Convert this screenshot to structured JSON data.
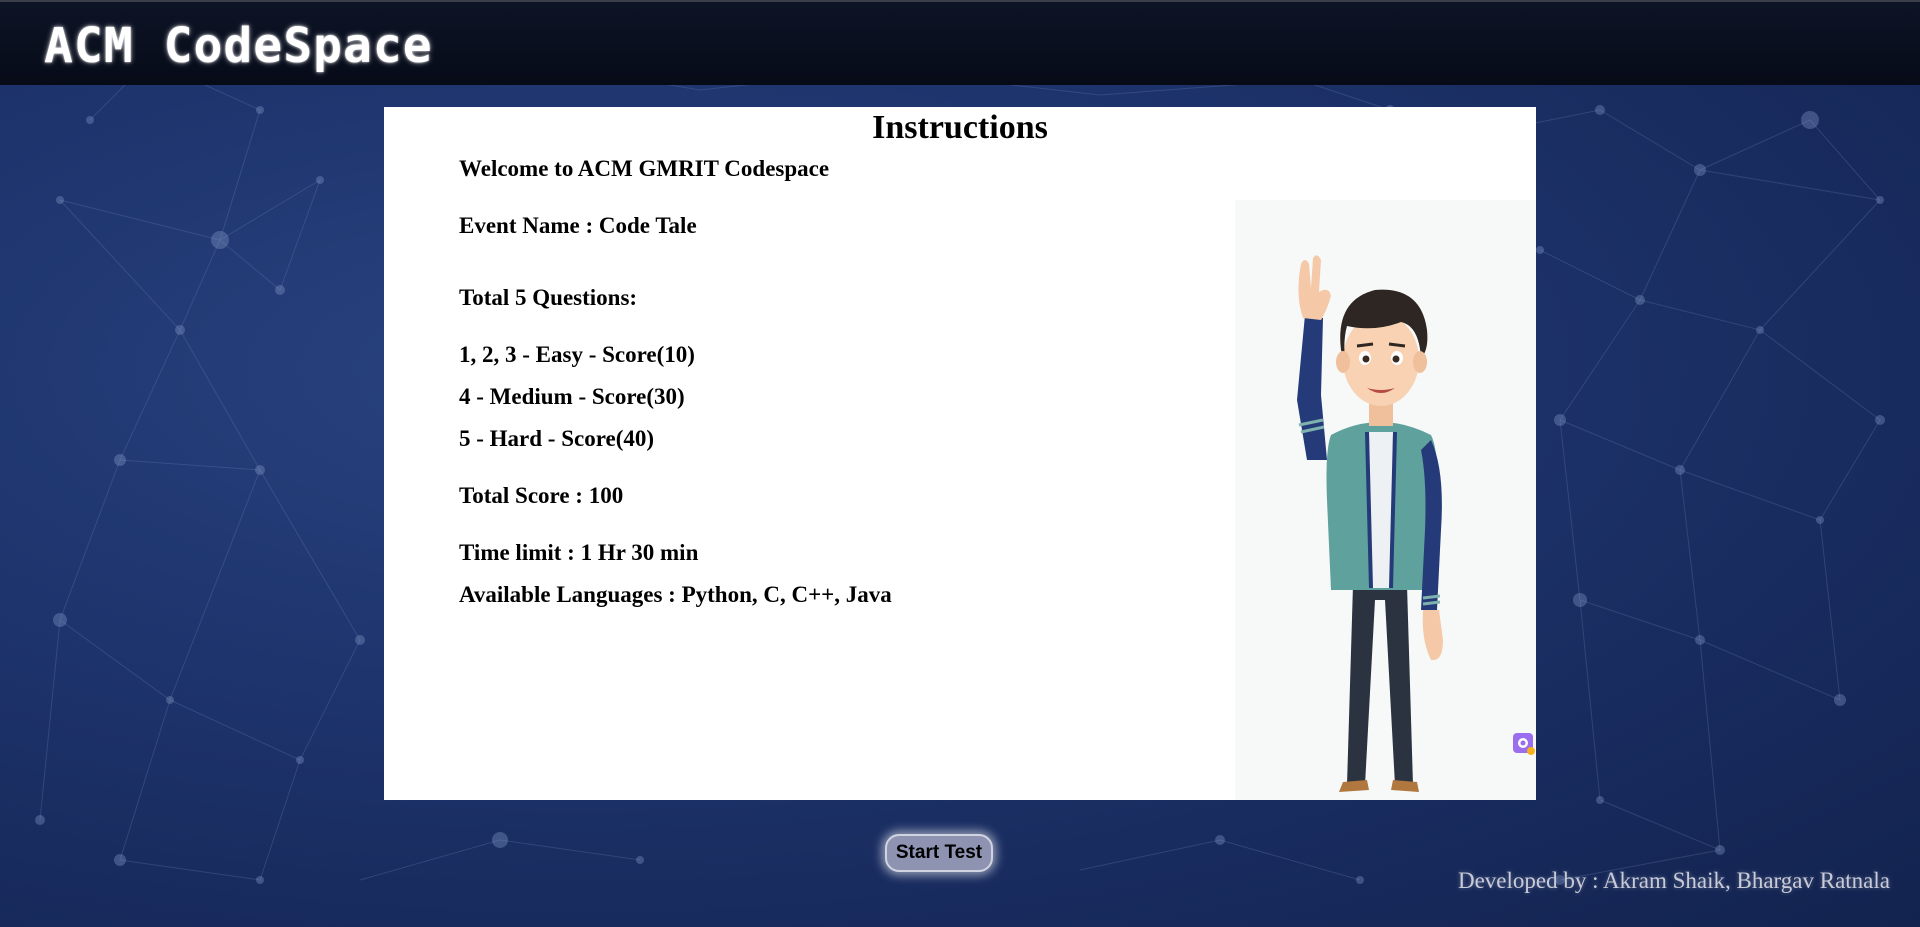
{
  "header": {
    "title": "ACM CodeSpace"
  },
  "instructions": {
    "title": "Instructions",
    "welcome": "Welcome to ACM GMRIT Codespace",
    "event_name": "Event Name : Code Tale",
    "total_questions": "Total 5 Questions:",
    "q_easy": "1, 2, 3 - Easy - Score(10)",
    "q_medium": "4 - Medium - Score(30)",
    "q_hard": "5 - Hard - Score(40)",
    "total_score": "Total Score : 100",
    "time_limit": "Time limit : 1 Hr 30 min",
    "languages": "Available Languages : Python, C, C++, Java"
  },
  "actions": {
    "start_label": "Start Test"
  },
  "footer": {
    "credit": "Developed by :  Akram Shaik,  Bhargav Ratnala"
  },
  "colors": {
    "background": "#1f3670",
    "header": "#070b18",
    "panel": "#ffffff",
    "button": "#8e93b2"
  },
  "icons": {
    "illustration": "waving-man-illustration",
    "watermark": "app-watermark-icon"
  }
}
